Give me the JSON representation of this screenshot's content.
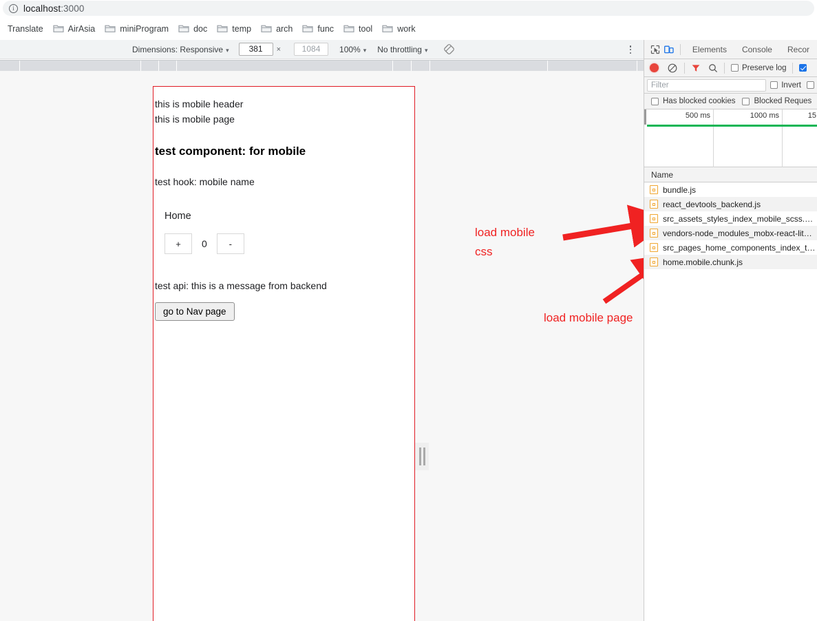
{
  "browser": {
    "address": "localhost:3000",
    "address_host": "localhost",
    "address_port": ":3000",
    "info_glyph": "i",
    "bookmarks": [
      {
        "label": "Translate",
        "has_folder": false
      },
      {
        "label": "AirAsia",
        "has_folder": true
      },
      {
        "label": "miniProgram",
        "has_folder": true
      },
      {
        "label": "doc",
        "has_folder": true
      },
      {
        "label": "temp",
        "has_folder": true
      },
      {
        "label": "arch",
        "has_folder": true
      },
      {
        "label": "func",
        "has_folder": true
      },
      {
        "label": "tool",
        "has_folder": true
      },
      {
        "label": "work",
        "has_folder": true
      }
    ]
  },
  "device_toolbar": {
    "dimensions_label": "Dimensions: Responsive",
    "dimensions_caret": "▾",
    "width_value": "381",
    "height_placeholder": "1084",
    "times_symbol": "×",
    "zoom_label": "100%",
    "zoom_caret": "▾",
    "throttle_label": "No throttling",
    "throttle_caret": "▾",
    "rotate_icon": "rotate-icon",
    "menu_icon": "kebab-menu-icon"
  },
  "page": {
    "header_text": "this is mobile header",
    "page_text": "this is mobile page",
    "component_heading": "test component: for mobile",
    "hook_text": "test hook: mobile name",
    "counter_title": "Home",
    "increment_label": "+",
    "counter_value": "0",
    "decrement_label": "-",
    "api_text": "test api: this is a message from backend",
    "nav_button_label": "go to Nav page"
  },
  "annotations": [
    {
      "text": "load mobile\ncss",
      "color": "#f02222"
    },
    {
      "text": "load mobile page",
      "color": "#f02222"
    }
  ],
  "devtools": {
    "inspect_icon": "inspect-element-icon",
    "device_toggle_icon": "device-toolbar-icon",
    "tabs": [
      {
        "label": "Elements"
      },
      {
        "label": "Console"
      },
      {
        "label": "Recor"
      }
    ],
    "network_controls": {
      "record_icon": "record-stop-icon",
      "clear_icon": "clear-network-icon",
      "filter_icon": "filter-funnel-icon",
      "search_icon": "search-icon",
      "preserve_log_label": "Preserve log",
      "preserve_log_checked": false,
      "disable_cache_checked": true
    },
    "filter": {
      "placeholder": "Filter",
      "invert_label": "Invert",
      "invert_checked": false,
      "extra_checked": false
    },
    "filter_row2": {
      "has_blocked_cookies_label": "Has blocked cookies",
      "has_blocked_cookies_checked": false,
      "blocked_requests_label": "Blocked Reques",
      "blocked_requests_checked": false
    },
    "overview": {
      "ticks": [
        "500 ms",
        "1000 ms",
        "15"
      ],
      "load_line_color": "#0db654"
    },
    "list": {
      "column_header": "Name",
      "rows": [
        {
          "name": "bundle.js"
        },
        {
          "name": "react_devtools_backend.js"
        },
        {
          "name": "src_assets_styles_index_mobile_scss.c…"
        },
        {
          "name": "vendors-node_modules_mobx-react-lit…"
        },
        {
          "name": "src_pages_home_components_index_t…"
        },
        {
          "name": "home.mobile.chunk.js"
        }
      ]
    }
  },
  "colors": {
    "accent_red": "#e01b24",
    "annotation_red": "#f02222",
    "file_icon_border": "#f0a732",
    "load_event_green": "#0db654",
    "checkbox_blue": "#1a73e8"
  }
}
